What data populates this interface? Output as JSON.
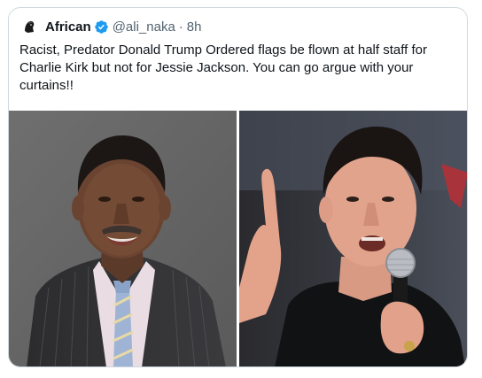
{
  "tweet": {
    "author_name": "African",
    "handle": "@ali_naka",
    "separator": "·",
    "time": "8h",
    "text": "Racist, Predator Donald Trump Ordered flags be flown at half staff for Charlie Kirk but not for Jessie Jackson. You can go argue with your curtains!!"
  },
  "icons": {
    "avatar": "avatar-icon",
    "verified": "verified-badge-icon"
  },
  "colors": {
    "verified_blue": "#1d9bf0",
    "border": "#cfd9de",
    "secondary_text": "#536471",
    "primary_text": "#0f1419"
  },
  "media": [
    {
      "name": "photo-left"
    },
    {
      "name": "photo-right"
    }
  ]
}
